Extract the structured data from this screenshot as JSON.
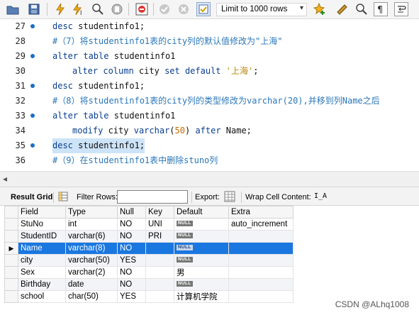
{
  "toolbar": {
    "limit_label": "Limit to 1000 rows",
    "icons": [
      "open-file-icon",
      "save-icon",
      "execute-icon",
      "execute-current-icon",
      "explain-icon",
      "stop-icon",
      "toggle-error-icon",
      "commit-icon",
      "rollback-icon",
      "autocommit-icon",
      "limit-dropdown",
      "add-snippet-icon",
      "beautify-icon",
      "find-icon",
      "invisible-chars-icon",
      "wrap-icon"
    ]
  },
  "editor": {
    "lines": [
      {
        "num": "27",
        "parts": [
          {
            "t": "desc",
            "c": "kw"
          },
          {
            "t": " studentinfo1;",
            "c": ""
          }
        ]
      },
      {
        "num": "28",
        "parts": [
          {
            "t": "#（7）将studentinfo1表的city列的默认值修改为\"上海\"",
            "c": "cm"
          }
        ]
      },
      {
        "num": "29",
        "parts": [
          {
            "t": "alter table",
            "c": "kw"
          },
          {
            "t": " studentinfo1",
            "c": ""
          }
        ]
      },
      {
        "num": "30",
        "parts": [
          {
            "t": "alter column",
            "c": "kw"
          },
          {
            "t": " city ",
            "c": ""
          },
          {
            "t": "set default",
            "c": "kw"
          },
          {
            "t": " '上海'",
            "c": "st"
          },
          {
            "t": ";",
            "c": ""
          }
        ]
      },
      {
        "num": "31",
        "parts": [
          {
            "t": "desc",
            "c": "kw"
          },
          {
            "t": " studentinfo1;",
            "c": ""
          }
        ]
      },
      {
        "num": "32",
        "parts": [
          {
            "t": "#（8）将studentinfo1表的city列的类型修改为varchar(20),并移到列Name之后",
            "c": "cm"
          }
        ]
      },
      {
        "num": "33",
        "parts": [
          {
            "t": "alter table",
            "c": "kw"
          },
          {
            "t": " studentinfo1",
            "c": ""
          }
        ]
      },
      {
        "num": "34",
        "parts": [
          {
            "t": "modify",
            "c": "kw"
          },
          {
            "t": " city ",
            "c": ""
          },
          {
            "t": "varchar",
            "c": "kw"
          },
          {
            "t": "(",
            "c": ""
          },
          {
            "t": "50",
            "c": "nm"
          },
          {
            "t": ") ",
            "c": ""
          },
          {
            "t": "after",
            "c": "kw"
          },
          {
            "t": " Name;",
            "c": ""
          }
        ]
      },
      {
        "num": "35",
        "parts": [
          {
            "t": "desc",
            "c": "kw"
          },
          {
            "t": " studentinfo1;",
            "c": ""
          }
        ]
      },
      {
        "num": "36",
        "parts": [
          {
            "t": "#（9）在studentinfo1表中删除stuno列",
            "c": "cm"
          }
        ]
      }
    ]
  },
  "result_toolbar": {
    "result_grid": "Result Grid",
    "filter_rows": "Filter Rows:",
    "export": "Export:",
    "wrap": "Wrap Cell Content:"
  },
  "grid": {
    "columns": [
      "Field",
      "Type",
      "Null",
      "Key",
      "Default",
      "Extra"
    ],
    "null_badge": "NULL",
    "rows": [
      {
        "field": "StuNo",
        "type": "int",
        "null": "NO",
        "key": "UNI",
        "default": "NULL",
        "extra": "auto_increment"
      },
      {
        "field": "StudentID",
        "type": "varchar(6)",
        "null": "NO",
        "key": "PRI",
        "default": "NULL",
        "extra": ""
      },
      {
        "field": "Name",
        "type": "varchar(8)",
        "null": "NO",
        "key": "",
        "default": "NULL",
        "extra": ""
      },
      {
        "field": "city",
        "type": "varchar(50)",
        "null": "YES",
        "key": "",
        "default": "NULL",
        "extra": ""
      },
      {
        "field": "Sex",
        "type": "varchar(2)",
        "null": "NO",
        "key": "",
        "default": "男",
        "extra": ""
      },
      {
        "field": "Birthday",
        "type": "date",
        "null": "NO",
        "key": "",
        "default": "NULL",
        "extra": ""
      },
      {
        "field": "school",
        "type": "char(50)",
        "null": "YES",
        "key": "",
        "default": "计算机学院",
        "extra": ""
      }
    ]
  },
  "watermark": "CSDN @ALhq1008"
}
